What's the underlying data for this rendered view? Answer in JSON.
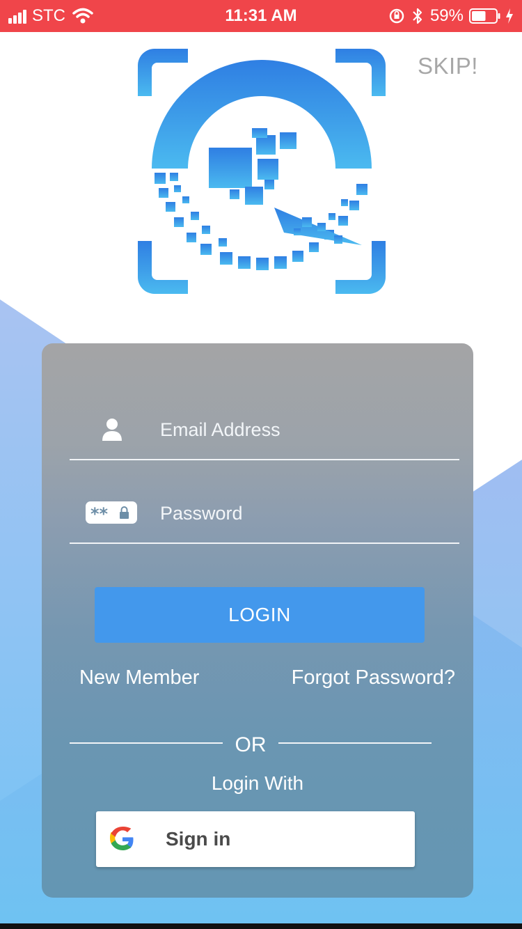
{
  "status_bar": {
    "carrier": "STC",
    "time": "11:31 AM",
    "battery_percent": "59%",
    "battery_level": 0.59,
    "background_color": "#f0454a"
  },
  "header": {
    "skip_label": "SKIP!"
  },
  "logo": {
    "icon": "qr-scan-logo",
    "primary_color": "#3b8ee6"
  },
  "login_form": {
    "email_placeholder": "Email Address",
    "email_icon": "user-icon",
    "password_placeholder": "Password",
    "password_icon": "password-icon",
    "login_button_label": "LOGIN",
    "login_button_color": "#4398ec",
    "new_member_label": "New Member",
    "forgot_password_label": "Forgot Password?",
    "or_label": "OR",
    "login_with_label": "Login With",
    "google_button_label": "Sign in",
    "google_icon": "google-icon"
  }
}
